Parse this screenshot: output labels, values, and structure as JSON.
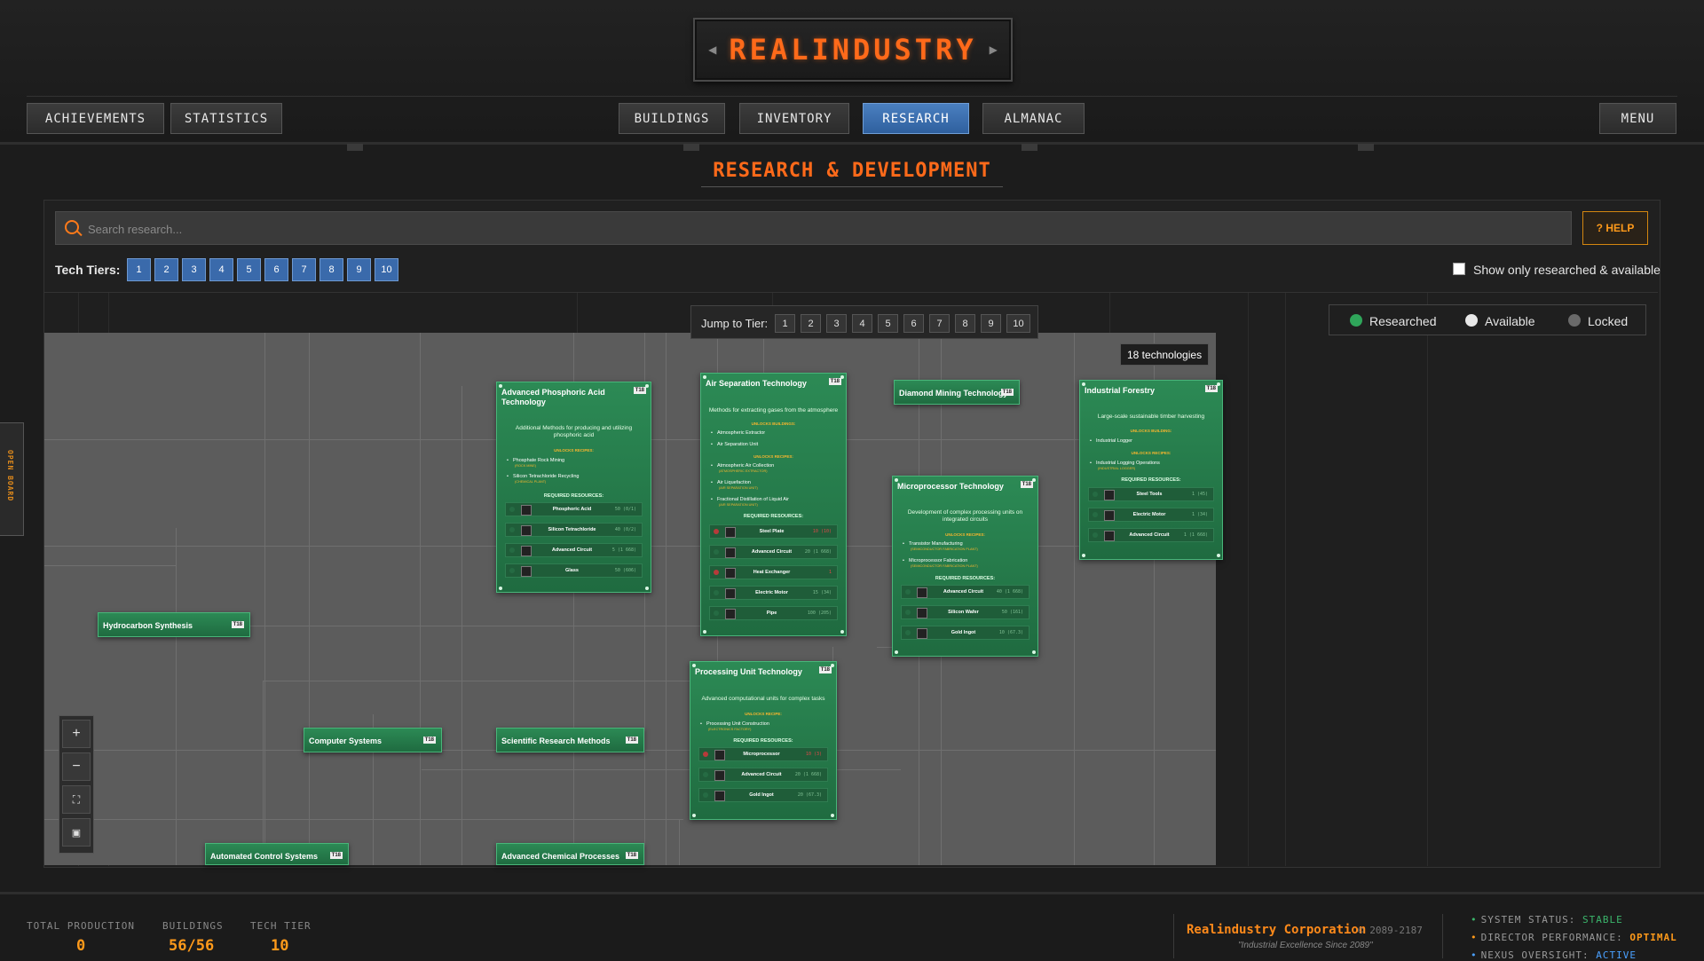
{
  "header": {
    "logo": "REALINDUSTRY",
    "nav_left": [
      "ACHIEVEMENTS",
      "STATISTICS"
    ],
    "nav_center": [
      "BUILDINGS",
      "INVENTORY",
      "RESEARCH",
      "ALMANAC"
    ],
    "active_tab": "RESEARCH",
    "menu": "MENU"
  },
  "page_title": "RESEARCH & DEVELOPMENT",
  "search": {
    "placeholder": "Search research..."
  },
  "help_label": "? HELP",
  "tech_tiers": {
    "label": "Tech Tiers:",
    "tiers": [
      "1",
      "2",
      "3",
      "4",
      "5",
      "6",
      "7",
      "8",
      "9",
      "10"
    ]
  },
  "filter": {
    "label": "Show only researched & available",
    "checked": false
  },
  "jump": {
    "label": "Jump to Tier:",
    "tiers": [
      "1",
      "2",
      "3",
      "4",
      "5",
      "6",
      "7",
      "8",
      "9",
      "10"
    ]
  },
  "legend": [
    {
      "label": "Researched",
      "color": "#2fa55a"
    },
    {
      "label": "Available",
      "color": "#e8e8e8"
    },
    {
      "label": "Locked",
      "color": "#6a6a6a"
    }
  ],
  "tech_count": "18 technologies",
  "side_tab": "OPEN BOARD",
  "cards": {
    "phosphoric": {
      "title": "Advanced Phosphoric Acid Technology",
      "tier": "T18",
      "desc": "Additional Methods for producing and utilizing phosphoric acid",
      "unlocks_recipes": "UNLOCKS RECIPES:",
      "recipes": [
        {
          "name": "Phosphate Rock Mining",
          "sub": "(ROCK MINE)"
        },
        {
          "name": "Silicon Tetrachloride Recycling",
          "sub": "(CHEMICAL PLANT)"
        }
      ],
      "required": "REQUIRED RESOURCES:",
      "resources": [
        {
          "name": "Phosphoric Acid",
          "value": "50 (0/1)"
        },
        {
          "name": "Silicon Tetrachloride",
          "value": "40 (0/2)"
        },
        {
          "name": "Advanced Circuit",
          "value": "5 (1 668)"
        },
        {
          "name": "Glass",
          "value": "50 (606)"
        }
      ]
    },
    "air": {
      "title": "Air Separation Technology",
      "tier": "T18",
      "desc": "Methods for extracting gases from the atmosphere",
      "unlocks_buildings": "UNLOCKS BUILDINGS:",
      "buildings": [
        "Atmospheric Extractor",
        "Air Separation Unit"
      ],
      "unlocks_recipes": "UNLOCKS RECIPES:",
      "recipes": [
        {
          "name": "Atmospheric Air Collection",
          "sub": "(ATMOSPHERIC EXTRACTOR)"
        },
        {
          "name": "Air Liquefaction",
          "sub": "(AIR SEPARATION UNIT)"
        },
        {
          "name": "Fractional Distillation of Liquid Air",
          "sub": "(AIR SEPARATION UNIT)"
        }
      ],
      "required": "REQUIRED RESOURCES:",
      "resources": [
        {
          "name": "Steel Plate",
          "value": "10 (10)",
          "bad": true
        },
        {
          "name": "Advanced Circuit",
          "value": "20 (1 668)"
        },
        {
          "name": "Heat Exchanger",
          "value": "1",
          "bad": true
        },
        {
          "name": "Electric Motor",
          "value": "15 (34)"
        },
        {
          "name": "Pipe",
          "value": "100 (205)"
        }
      ]
    },
    "diamond": {
      "title": "Diamond Mining Technology",
      "tier": "T18"
    },
    "microprocessor": {
      "title": "Microprocessor Technology",
      "tier": "T18",
      "desc": "Development of complex processing units on integrated circuits",
      "unlocks_recipes": "UNLOCKS RECIPES:",
      "recipes": [
        {
          "name": "Transistor Manufacturing",
          "sub": "(SEMICONDUCTOR FABRICATION PLANT)"
        },
        {
          "name": "Microprocessor Fabrication",
          "sub": "(SEMICONDUCTOR FABRICATION PLANT)"
        }
      ],
      "required": "REQUIRED RESOURCES:",
      "resources": [
        {
          "name": "Advanced Circuit",
          "value": "40 (1 668)"
        },
        {
          "name": "Silicon Wafer",
          "value": "50 (161)"
        },
        {
          "name": "Gold Ingot",
          "value": "10 (67.3)"
        }
      ]
    },
    "forestry": {
      "title": "Industrial Forestry",
      "tier": "T18",
      "desc": "Large-scale sustainable timber harvesting",
      "unlocks_building": "UNLOCKS BUILDING:",
      "buildings": [
        "Industrial Logger"
      ],
      "unlocks_recipes": "UNLOCKS RECIPES:",
      "recipes": [
        {
          "name": "Industrial Logging Operations",
          "sub": "(INDUSTRIAL LOGGER)"
        }
      ],
      "required": "REQUIRED RESOURCES:",
      "resources": [
        {
          "name": "Steel Tools",
          "value": "1 (45)"
        },
        {
          "name": "Electric Motor",
          "value": "1 (34)"
        },
        {
          "name": "Advanced Circuit",
          "value": "1 (1 668)"
        }
      ]
    },
    "processing": {
      "title": "Processing Unit Technology",
      "tier": "T18",
      "desc": "Advanced computational units for complex tasks",
      "unlocks_recipe": "UNLOCKS RECIPE:",
      "recipes": [
        {
          "name": "Processing Unit Construction",
          "sub": "(ELECTRONICS FACTORY)"
        }
      ],
      "required": "REQUIRED RESOURCES:",
      "resources": [
        {
          "name": "Microprocessor",
          "value": "10 (3)",
          "bad": true
        },
        {
          "name": "Advanced Circuit",
          "value": "20 (1 668)"
        },
        {
          "name": "Gold Ingot",
          "value": "20 (67.3)"
        }
      ]
    },
    "hydrocarbon": {
      "title": "Hydrocarbon Synthesis",
      "tier": "T18"
    },
    "computer": {
      "title": "Computer Systems",
      "tier": "T18"
    },
    "scientific": {
      "title": "Scientific Research Methods",
      "tier": "T18"
    },
    "automated": {
      "title": "Automated Control Systems",
      "tier": "T18"
    },
    "chemical": {
      "title": "Advanced Chemical Processes",
      "tier": "T18"
    }
  },
  "footer": {
    "total_production_label": "TOTAL PRODUCTION",
    "total_production": "0",
    "buildings_label": "BUILDINGS",
    "buildings": "56/56",
    "tech_tier_label": "TECH TIER",
    "tech_tier": "10",
    "corp": "Realindustry Corporation",
    "years": "© 2089-2187",
    "tagline": "\"Industrial Excellence Since 2089\"",
    "status": [
      {
        "label": "SYSTEM STATUS:",
        "value": "STABLE"
      },
      {
        "label": "DIRECTOR PERFORMANCE:",
        "value": "OPTIMAL"
      },
      {
        "label": "NEXUS OVERSIGHT:",
        "value": "ACTIVE"
      }
    ]
  }
}
